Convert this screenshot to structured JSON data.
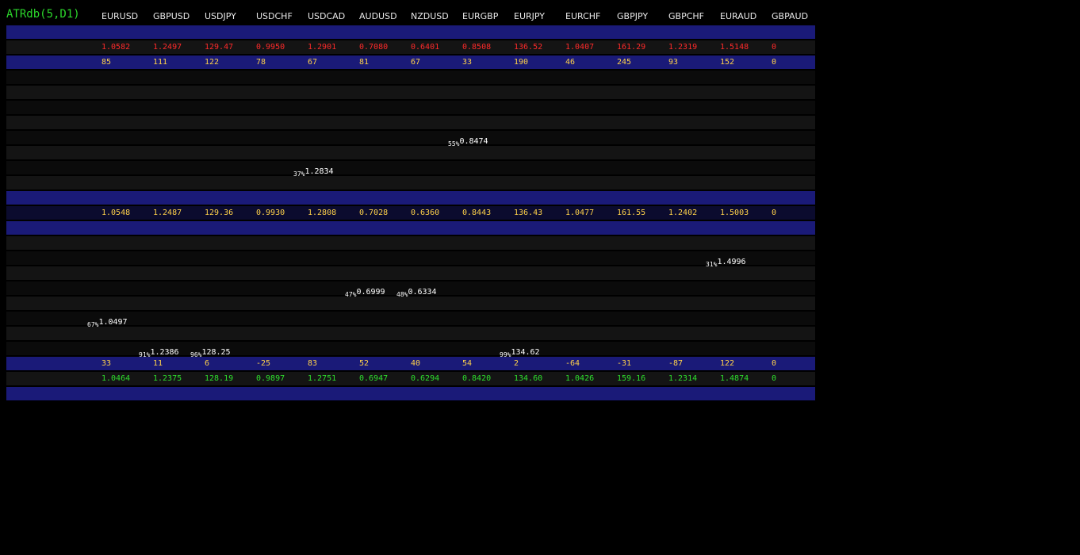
{
  "indicator_title": "ATRdb(5,D1)",
  "symbols": [
    "EURUSD",
    "GBPUSD",
    "USDJPY",
    "USDCHF",
    "USDCAD",
    "AUDUSD",
    "NZDUSD",
    "EURGBP",
    "EURJPY",
    "EURCHF",
    "GBPJPY",
    "GBPCHF",
    "EURAUD",
    "GBPAUD"
  ],
  "colors": {
    "blue_band": "#1a1a78",
    "dark_band": "#141414",
    "darker_band": "#0b0b0b",
    "navy_band": "#0b0b2e",
    "high": "#ff2a2a",
    "atr": "#ffd24a",
    "mid": "#ffd24a",
    "diff": "#ffd24a",
    "low": "#2ee02e"
  },
  "rows": [
    {
      "bg": "blue_band"
    },
    {
      "bg": "dark_band",
      "kind": "high",
      "values": [
        "1.0582",
        "1.2497",
        "129.47",
        "0.9950",
        "1.2901",
        "0.7080",
        "0.6401",
        "0.8508",
        "136.52",
        "1.0407",
        "161.29",
        "1.2319",
        "1.5148",
        "0"
      ]
    },
    {
      "bg": "blue_band",
      "kind": "atr",
      "values": [
        "85",
        "111",
        "122",
        "78",
        "67",
        "81",
        "67",
        "33",
        "190",
        "46",
        "245",
        "93",
        "152",
        "0"
      ]
    },
    {
      "bg": "darker_band"
    },
    {
      "bg": "dark_band"
    },
    {
      "bg": "darker_band"
    },
    {
      "bg": "dark_band"
    },
    {
      "bg": "darker_band",
      "marks": [
        {
          "col": 7,
          "pct": "55%",
          "price": "0.8474"
        }
      ]
    },
    {
      "bg": "dark_band"
    },
    {
      "bg": "darker_band",
      "marks": [
        {
          "col": 4,
          "pct": "37%",
          "price": "1.2834"
        }
      ]
    },
    {
      "bg": "dark_band"
    },
    {
      "bg": "blue_band"
    },
    {
      "bg": "navy_band",
      "kind": "mid",
      "values": [
        "1.0548",
        "1.2487",
        "129.36",
        "0.9930",
        "1.2808",
        "0.7028",
        "0.6360",
        "0.8443",
        "136.43",
        "1.0477",
        "161.55",
        "1.2402",
        "1.5003",
        "0"
      ]
    },
    {
      "bg": "blue_band"
    },
    {
      "bg": "dark_band"
    },
    {
      "bg": "darker_band",
      "marks": [
        {
          "col": 12,
          "pct": "31%",
          "price": "1.4996"
        }
      ]
    },
    {
      "bg": "dark_band"
    },
    {
      "bg": "darker_band",
      "marks": [
        {
          "col": 5,
          "pct": "47%",
          "price": "0.6999"
        },
        {
          "col": 6,
          "pct": "48%",
          "price": "0.6334"
        }
      ]
    },
    {
      "bg": "dark_band"
    },
    {
      "bg": "darker_band",
      "marks": [
        {
          "col": 0,
          "pct": "67%",
          "price": "1.0497"
        }
      ]
    },
    {
      "bg": "dark_band"
    },
    {
      "bg": "darker_band",
      "marks": [
        {
          "col": 1,
          "pct": "91%",
          "price": "1.2386"
        },
        {
          "col": 2,
          "pct": "96%",
          "price": "128.25"
        },
        {
          "col": 8,
          "pct": "99%",
          "price": "134.62"
        }
      ]
    },
    {
      "bg": "blue_band",
      "kind": "diff",
      "values": [
        "33",
        "11",
        "6",
        "-25",
        "83",
        "52",
        "40",
        "54",
        "2",
        "-64",
        "-31",
        "-87",
        "122",
        "0"
      ]
    },
    {
      "bg": "dark_band",
      "kind": "low",
      "values": [
        "1.0464",
        "1.2375",
        "128.19",
        "0.9897",
        "1.2751",
        "0.6947",
        "0.6294",
        "0.8420",
        "134.60",
        "1.0426",
        "159.16",
        "1.2314",
        "1.4874",
        "0"
      ]
    },
    {
      "bg": "blue_band"
    }
  ]
}
